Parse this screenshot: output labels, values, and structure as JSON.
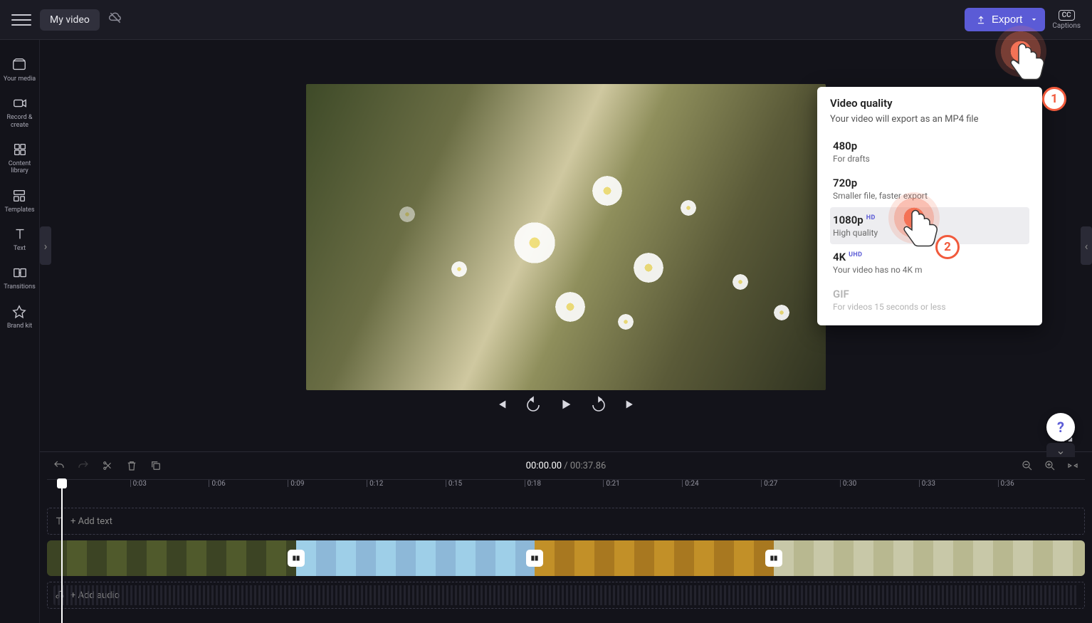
{
  "app": {
    "project_name": "My video",
    "export_button": "Export",
    "captions_label": "Captions",
    "cc_label": "CC"
  },
  "sidebar": {
    "items": [
      {
        "label": "Your media"
      },
      {
        "label": "Record & create"
      },
      {
        "label": "Content library"
      },
      {
        "label": "Templates"
      },
      {
        "label": "Text"
      },
      {
        "label": "Transitions"
      },
      {
        "label": "Brand kit"
      }
    ]
  },
  "export_menu": {
    "title": "Video quality",
    "subtitle": "Your video will export as an MP4 file",
    "options": [
      {
        "label": "480p",
        "desc": "For drafts",
        "badge": "",
        "state": "enabled"
      },
      {
        "label": "720p",
        "desc": "Smaller file, faster export",
        "badge": "",
        "state": "enabled"
      },
      {
        "label": "1080p",
        "desc": "High quality",
        "badge": "HD",
        "state": "selected"
      },
      {
        "label": "4K",
        "desc": "Your video has no 4K m",
        "badge": "UHD",
        "state": "enabled"
      },
      {
        "label": "GIF",
        "desc": "For videos 15 seconds or less",
        "badge": "",
        "state": "disabled"
      }
    ]
  },
  "timeline": {
    "current": "00:00.00",
    "duration": "00:37.86",
    "ticks": [
      "0:03",
      "0:06",
      "0:09",
      "0:12",
      "0:15",
      "0:18",
      "0:21",
      "0:24",
      "0:27",
      "0:30",
      "0:33",
      "0:36"
    ],
    "add_text": "+ Add text",
    "add_audio": "+ Add audio"
  },
  "annotations": {
    "step1": "1",
    "step2": "2"
  },
  "help": "?"
}
